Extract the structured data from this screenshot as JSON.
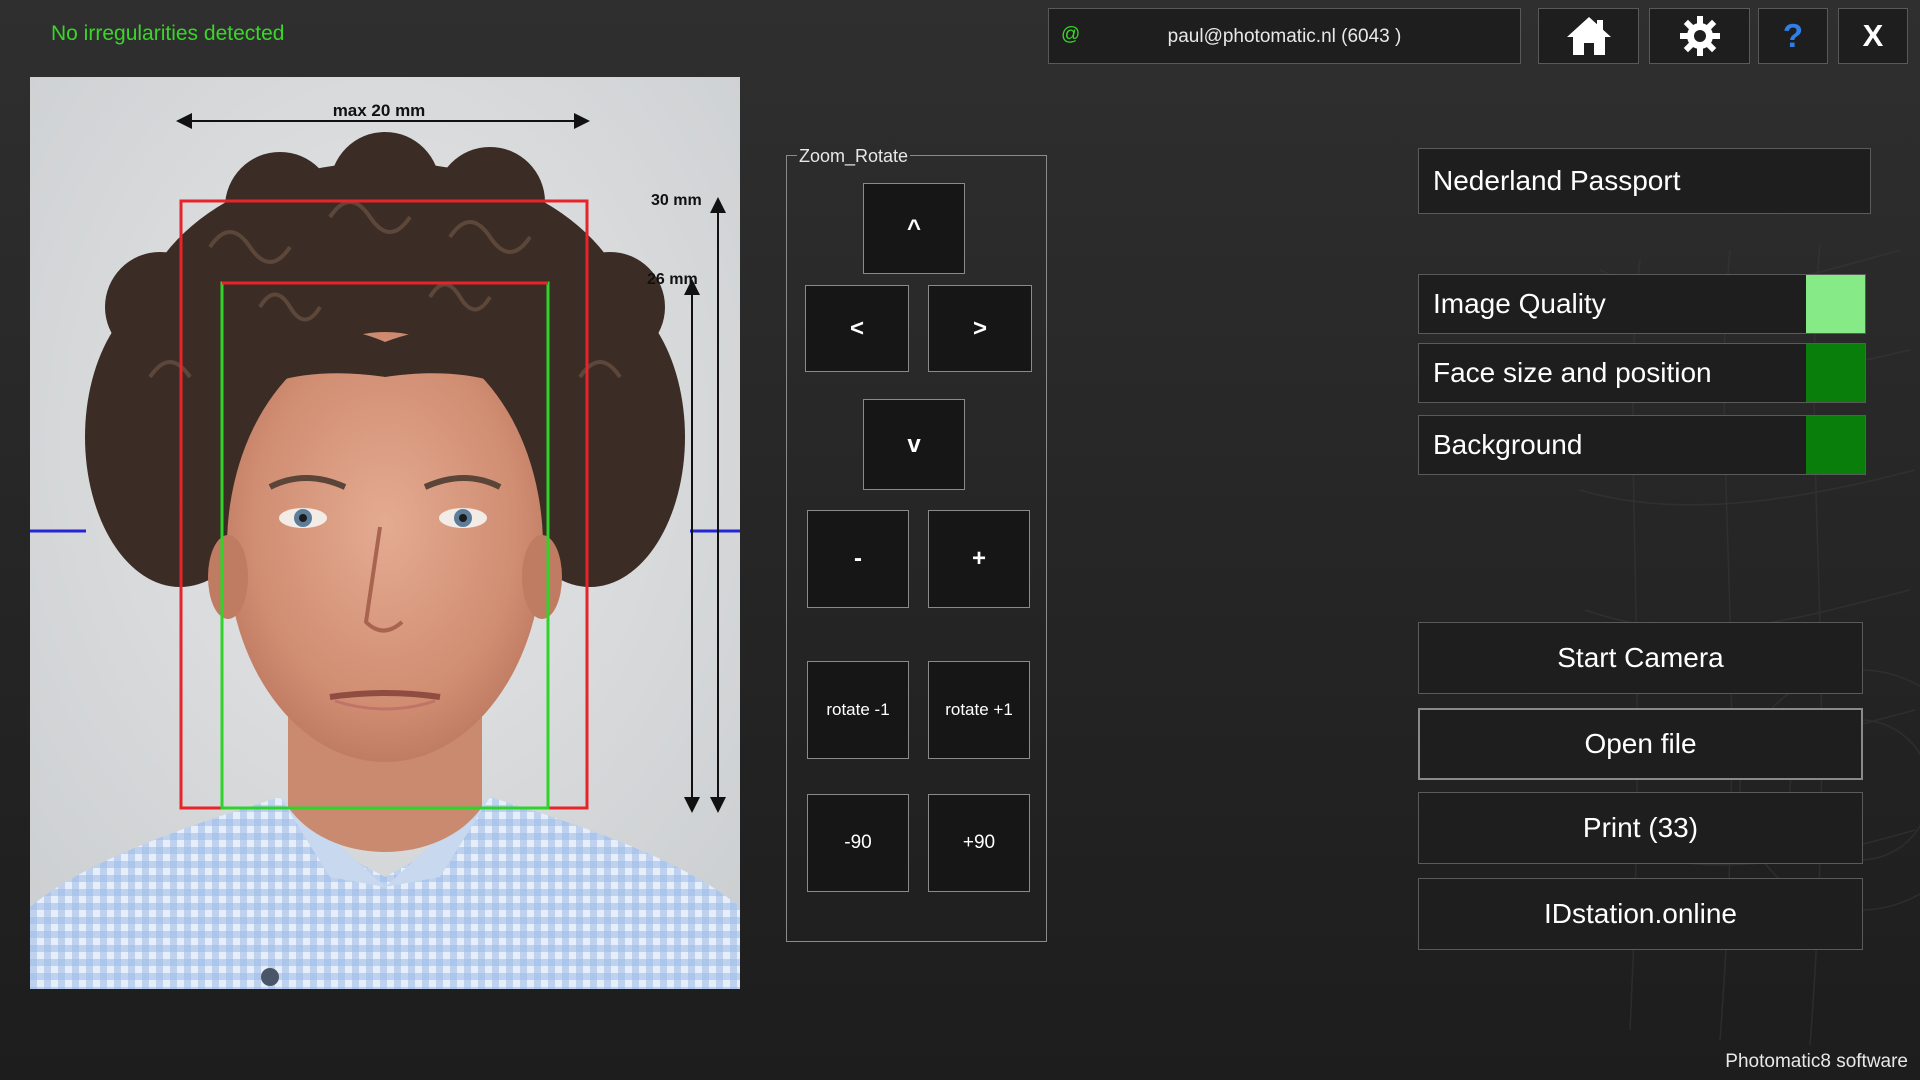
{
  "status": {
    "message": "No irregularities detected"
  },
  "account": {
    "at_symbol": "@",
    "user": "paul@photomatic.nl (6043 )"
  },
  "toolbar": {
    "home_icon": "home-icon",
    "settings_icon": "gear-icon",
    "help_glyph": "?",
    "close_glyph": "X"
  },
  "photo": {
    "max_width_label": "max 20 mm",
    "outer_height_label": "30 mm",
    "inner_height_label": "26 mm"
  },
  "zoom_rotate": {
    "title": "Zoom_Rotate",
    "up_label": "^",
    "left_label": "<",
    "right_label": ">",
    "down_label": "v",
    "zoom_out_label": "-",
    "zoom_in_label": "+",
    "rotate_minus_label": "rotate -1",
    "rotate_plus_label": "rotate +1",
    "rotate_minus_90_label": "-90",
    "rotate_plus_90_label": "+90"
  },
  "document_profile": "Nederland Passport",
  "checks": [
    {
      "label": "Image Quality",
      "color": "#86ea86"
    },
    {
      "label": "Face size and position",
      "color": "#0a7e0a"
    },
    {
      "label": "Background",
      "color": "#0a7e0a"
    }
  ],
  "actions": {
    "start_camera": "Start Camera",
    "open_file": "Open file",
    "print": "Print  (33)",
    "idstation": "IDstation.online"
  },
  "footer": {
    "brand": "Photomatic8 software"
  },
  "colors": {
    "status_green": "#39d628",
    "help_blue": "#2f7fe6",
    "outer_frame_red": "#e8242a",
    "inner_frame_green": "#2ed42a",
    "eye_line_blue": "#2525d8"
  }
}
